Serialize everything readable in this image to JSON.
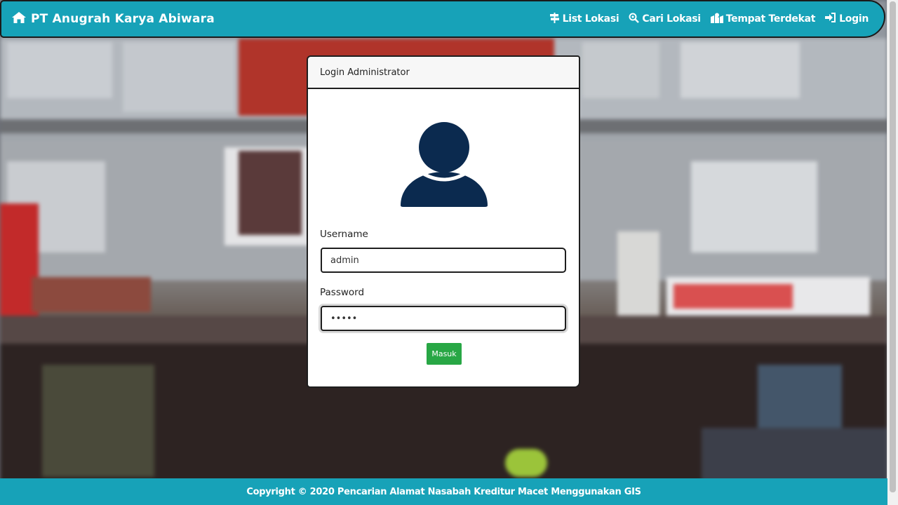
{
  "navbar": {
    "brand": "PT Anugrah Karya Abiwara",
    "brand_icon": "home-icon",
    "links": [
      {
        "label": "List Lokasi",
        "icon": "signs-icon"
      },
      {
        "label": "Cari Lokasi",
        "icon": "search-location-icon"
      },
      {
        "label": "Tempat Terdekat",
        "icon": "map-marked-icon"
      },
      {
        "label": "Login",
        "icon": "sign-in-icon"
      }
    ]
  },
  "login": {
    "header": "Login Administrator",
    "avatar_icon": "user-icon",
    "username_label": "Username",
    "username_value": "admin",
    "password_label": "Password",
    "password_value": "•••••",
    "submit_label": "Masuk"
  },
  "footer": {
    "text": "Copyright © 2020 Pencarian Alamat Nasabah Kreditur Macet Menggunakan GIS"
  },
  "colors": {
    "primary": "#17a2b8",
    "success": "#28a745",
    "avatar": "#0b2a4f"
  }
}
